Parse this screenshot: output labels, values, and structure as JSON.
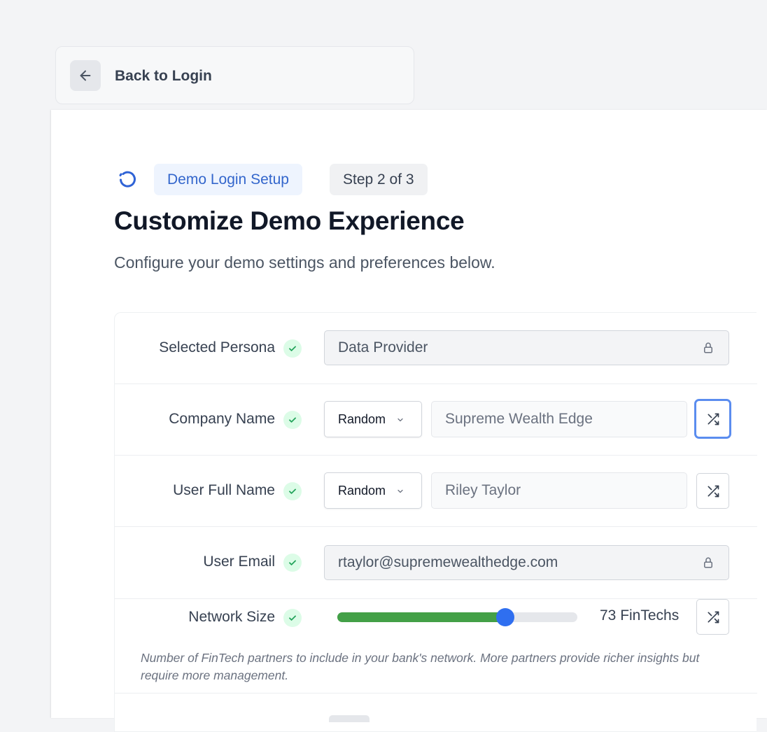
{
  "header": {
    "back_label": "Back to Login",
    "back_icon": "arrow-left-icon"
  },
  "page": {
    "badge_label": "Demo Login Setup",
    "step_label": "Step 2 of 3",
    "title": "Customize Demo Experience",
    "subtitle": "Configure your demo settings and preferences below."
  },
  "form": {
    "persona": {
      "label": "Selected Persona",
      "value": "Data Provider",
      "locked": true
    },
    "company": {
      "label": "Company Name",
      "mode": "Random",
      "value": "Supreme Wealth Edge"
    },
    "user_name": {
      "label": "User Full Name",
      "mode": "Random",
      "value": "Riley Taylor"
    },
    "email": {
      "label": "User Email",
      "value": "rtaylor@supremewealthedge.com",
      "locked": true
    },
    "network": {
      "label": "Network Size",
      "value": 73,
      "value_label": "73 FinTechs",
      "slider_fraction": 0.7,
      "help": "Number of FinTech partners to include in your bank's network. More partners provide richer insights but require more management."
    }
  },
  "colors": {
    "accent": "#2f6ff0",
    "badge_bg": "#eef4fe",
    "slider_fill": "#43a047",
    "check_bg": "#dcfce7",
    "check_mark": "#22a35a"
  }
}
